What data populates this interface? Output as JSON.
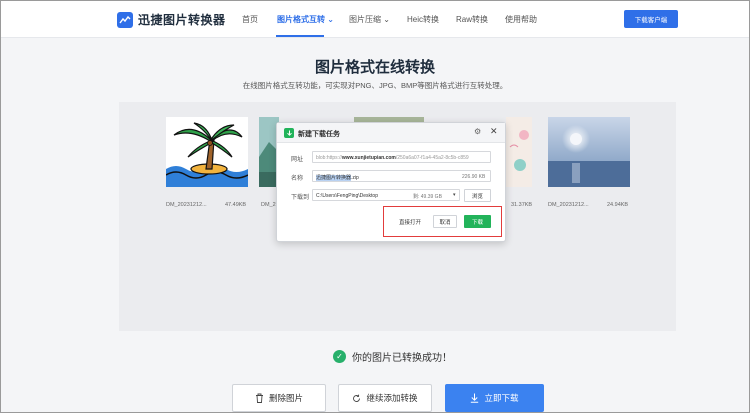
{
  "nav": {
    "brand": "迅捷图片转换器",
    "items": [
      {
        "label": "首页"
      },
      {
        "label": "图片格式互转"
      },
      {
        "label": "图片压缩"
      },
      {
        "label": "Heic转换"
      },
      {
        "label": "Raw转换"
      },
      {
        "label": "使用帮助"
      }
    ],
    "chevron": "⌄",
    "client_button": "下载客户端",
    "accent_color": "#2f6fe8"
  },
  "hero": {
    "title": "图片格式在线转换",
    "subtitle": "在线图片格式互转功能，可实现对PNG、JPG、BMP等图片格式进行互转处理。"
  },
  "thumbnails": [
    {
      "name": "DM_20231212...",
      "size": "47.49KB",
      "icon": "palm-tree-image"
    },
    {
      "name": "DM_2",
      "size": "",
      "icon": "landscape-image"
    },
    {
      "name": "",
      "size": "31.37KB",
      "icon": "pattern-image"
    },
    {
      "name": "DM_20231212...",
      "size": "24.94KB",
      "icon": "moon-sky-image"
    }
  ],
  "dialog": {
    "title": "新建下载任务",
    "url_label": "网址",
    "url_prefix": "blob:https://",
    "url_domain": "www.xunjietupian.com",
    "url_suffix": "/250a6a07-f1a4-45a2-8c5b-c859",
    "name_label": "名称",
    "file_name_highlight": "迅捷图片转换器",
    "file_ext": ".zip",
    "file_size": "226.90 KB",
    "save_label": "下载到",
    "save_path": "C:\\Users\\FengPing\\Desktop",
    "disk_free": "剩: 49.39 GB",
    "dropdown_arrow": "▾",
    "browse_button": "浏览",
    "open_button": "直接打开",
    "cancel_button": "取消",
    "download_button": "下载",
    "gear": "⚙",
    "close": "✕",
    "download_color": "#22b35a",
    "highlight_color": "#e23c3c"
  },
  "status": {
    "message": "你的图片已转换成功！",
    "check": "✓"
  },
  "actions": {
    "delete": "删除图片",
    "add": "继续添加转换",
    "download": "立即下载"
  }
}
